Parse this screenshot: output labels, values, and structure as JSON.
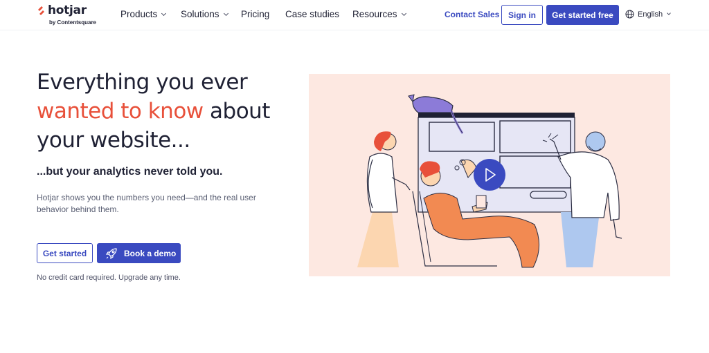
{
  "brand": {
    "name": "hotjar",
    "tagline": "by Contentsquare",
    "accent_color": "#e8503a",
    "primary_color": "#3a4ac0"
  },
  "nav": {
    "items": [
      {
        "label": "Products",
        "has_dropdown": true
      },
      {
        "label": "Solutions",
        "has_dropdown": true
      },
      {
        "label": "Pricing",
        "has_dropdown": false
      },
      {
        "label": "Case studies",
        "has_dropdown": false
      },
      {
        "label": "Resources",
        "has_dropdown": true
      }
    ],
    "contact_label": "Contact Sales",
    "signin_label": "Sign in",
    "get_started_free_label": "Get started free",
    "language": {
      "label": "English",
      "icon": "globe-icon"
    }
  },
  "hero": {
    "title_line1": "Everything you ever",
    "title_accent": "wanted to know",
    "title_after_accent": "about",
    "title_line3": "your website...",
    "subtitle": "...but your analytics never told you.",
    "description": "Hotjar shows you the numbers you need—and the real user behavior behind them.",
    "get_started_label": "Get started",
    "book_demo_label": "Book a demo",
    "book_demo_icon": "rocket-icon",
    "note": "No credit card required. Upgrade any time."
  },
  "illustration": {
    "background_color": "#fde8e1",
    "video_icon": "play-icon"
  }
}
